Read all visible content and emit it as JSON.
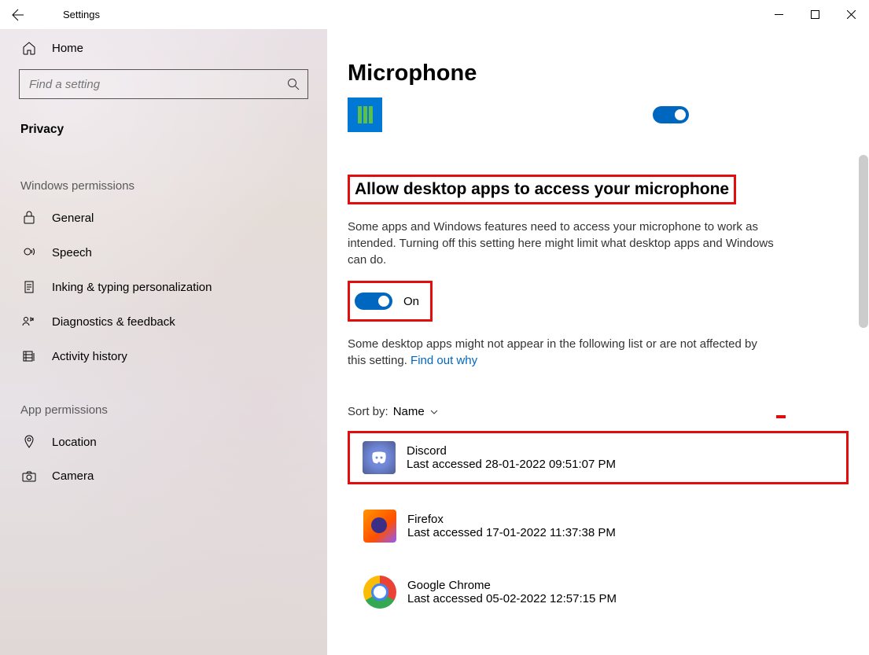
{
  "window": {
    "title": "Settings"
  },
  "sidebar": {
    "home_label": "Home",
    "search_placeholder": "Find a setting",
    "current_page": "Privacy",
    "groups": [
      {
        "label": "Windows permissions",
        "items": [
          {
            "label": "General"
          },
          {
            "label": "Speech"
          },
          {
            "label": "Inking & typing personalization"
          },
          {
            "label": "Diagnostics & feedback"
          },
          {
            "label": "Activity history"
          }
        ]
      },
      {
        "label": "App permissions",
        "items": [
          {
            "label": "Location"
          },
          {
            "label": "Camera"
          }
        ]
      }
    ]
  },
  "content": {
    "page_title": "Microphone",
    "section_heading": "Allow desktop apps to access your microphone",
    "section_desc": "Some apps and Windows features need to access your microphone to work as intended. Turning off this setting here might limit what desktop apps and Windows can do.",
    "toggle_state": "On",
    "note_text": "Some desktop apps might not appear in the following list or are not affected by this setting. ",
    "note_link": "Find out why",
    "sort_label": "Sort by:",
    "sort_value": "Name",
    "apps": [
      {
        "name": "Discord",
        "sub": "Last accessed 28-01-2022 09:51:07 PM",
        "icon": "discord",
        "boxed": true
      },
      {
        "name": "Firefox",
        "sub": "Last accessed 17-01-2022 11:37:38 PM",
        "icon": "firefox",
        "boxed": false
      },
      {
        "name": "Google Chrome",
        "sub": "Last accessed 05-02-2022 12:57:15 PM",
        "icon": "chrome",
        "boxed": false
      }
    ]
  }
}
